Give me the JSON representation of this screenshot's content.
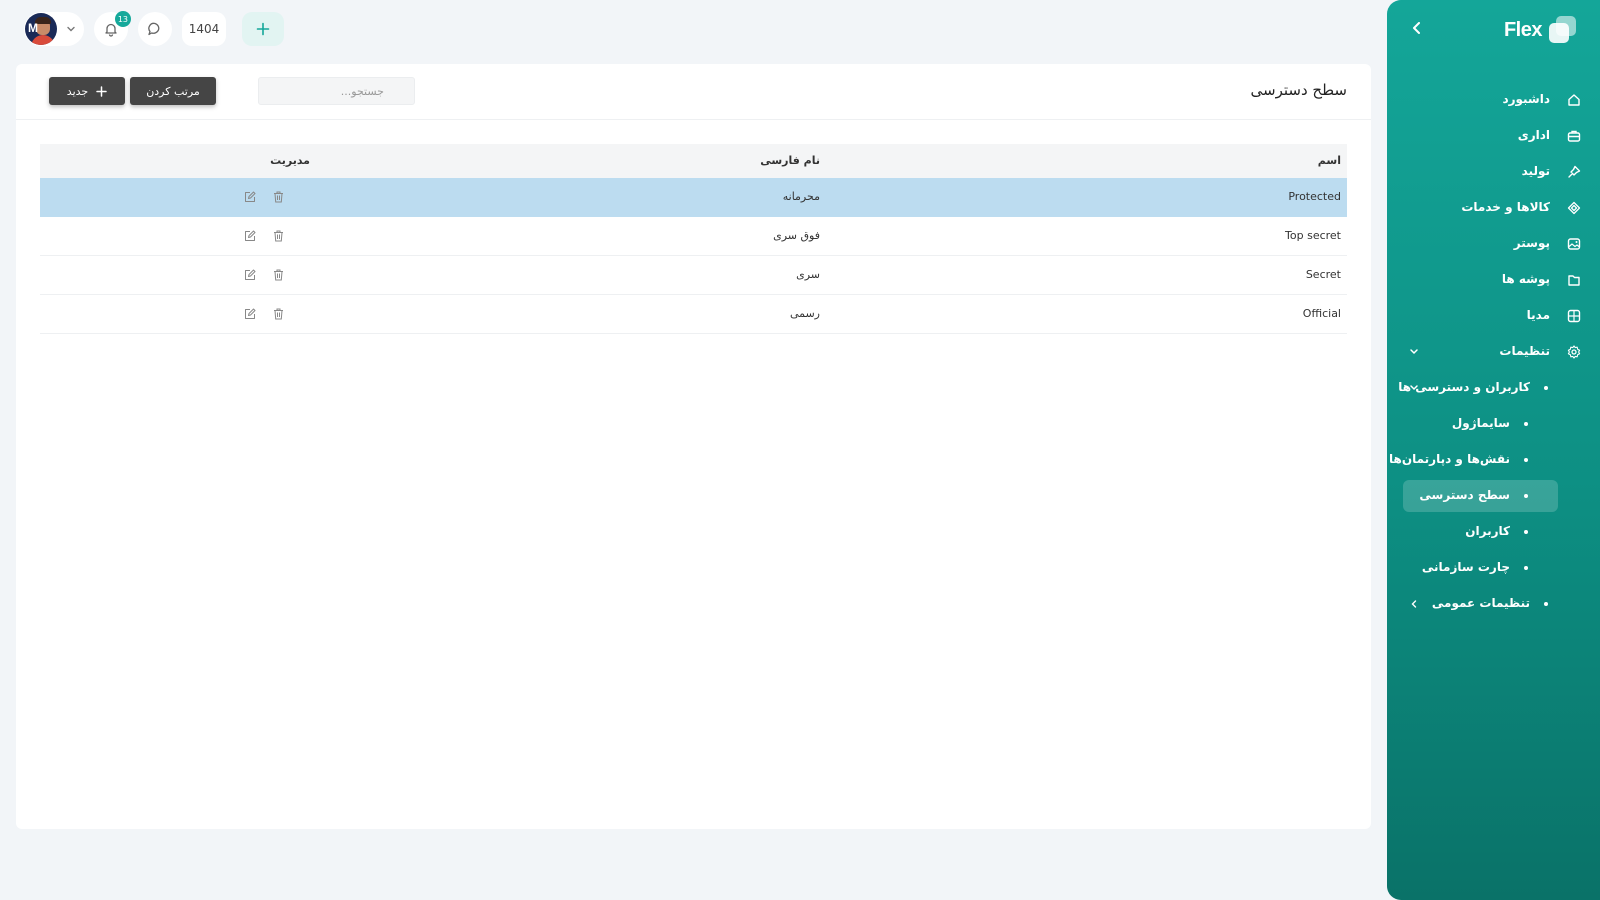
{
  "sidebar": {
    "brand": "Flex",
    "items": [
      {
        "label": "داشبورد",
        "icon": "home-icon"
      },
      {
        "label": "اداری",
        "icon": "briefcase-icon"
      },
      {
        "label": "تولید",
        "icon": "pin-icon"
      },
      {
        "label": "کالاها و خدمات",
        "icon": "diamond-icon"
      },
      {
        "label": "پوستر",
        "icon": "image-icon"
      },
      {
        "label": "پوشه ها",
        "icon": "folder-icon"
      },
      {
        "label": "مدیا",
        "icon": "grid-icon"
      },
      {
        "label": "تنظیمات",
        "icon": "gear-icon"
      }
    ],
    "settings_group": {
      "label": "کاربران و دسترسی ها",
      "children": [
        "سایماژول",
        "نقش‌ها و دپارتمان‌ها",
        "سطح دسترسی",
        "کاربران",
        "چارت سازمانی"
      ],
      "active": "سطح دسترسی"
    },
    "general_settings": "تنظیمات عمومی"
  },
  "topbar": {
    "notifications_count": "13",
    "year": "1404"
  },
  "page": {
    "title": "سطح دسترسی",
    "search_placeholder": "جستجو...",
    "sort_label": "مرتب کردن",
    "new_label": "جدید"
  },
  "table": {
    "headers": {
      "name": "اسم",
      "persian_name": "نام فارسی",
      "management": "مدیریت"
    },
    "rows": [
      {
        "name": "Protected",
        "persian_name": "محرمانه",
        "selected": true
      },
      {
        "name": "Top secret",
        "persian_name": "فوق سری",
        "selected": false
      },
      {
        "name": "Secret",
        "persian_name": "سری",
        "selected": false
      },
      {
        "name": "Official",
        "persian_name": "رسمی",
        "selected": false
      }
    ]
  },
  "colors": {
    "accent": "#14a699",
    "selected_row": "#bcdcf0",
    "dark_button": "#454545"
  }
}
